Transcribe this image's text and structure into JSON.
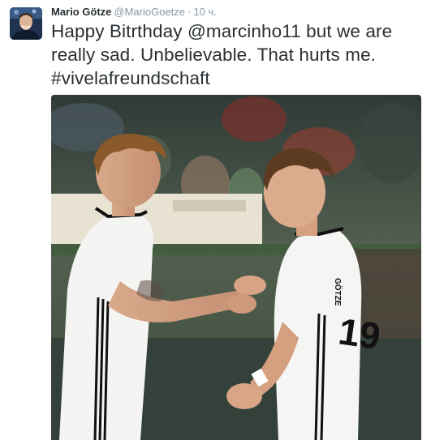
{
  "tweet": {
    "author_name": "Mario Götze",
    "handle": "@MarioGoetze",
    "separator": "·",
    "time": "10 ч.",
    "text_intro": "Happy Bitrthday ",
    "mention": "@marcinho11",
    "text_rest": " but we are really sad. Unbelievable. That hurts me. ",
    "hashtag": "#vivelafreundschaft",
    "photo_jersey_number": "19",
    "photo_jersey_name": "GÖTZE"
  }
}
